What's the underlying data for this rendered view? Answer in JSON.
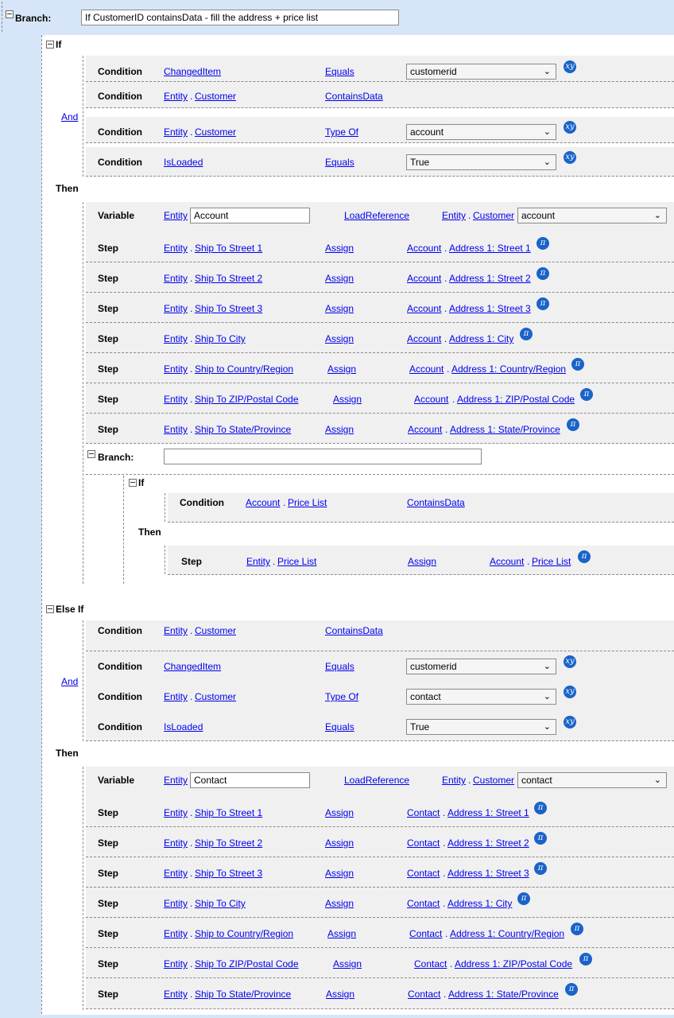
{
  "branch": {
    "label": "Branch:",
    "value": "If CustomerID containsData - fill the address + price list"
  },
  "if": {
    "label": "If"
  },
  "and": "And",
  "then": "Then",
  "else_if": {
    "label": "Else If"
  },
  "cond": "Condition",
  "var": "Variable",
  "step": "Step",
  "dot": ".",
  "ops": {
    "equals": "Equals",
    "contains": "ContainsData",
    "typeof": "Type Of",
    "assign": "Assign",
    "loadref": "LoadReference"
  },
  "fields": {
    "changed": "ChangedItem",
    "entity": "Entity",
    "customer": "Customer",
    "isloaded": "IsLoaded",
    "account": "Account",
    "contact": "Contact",
    "pricelist": "Price List",
    "st1": "Ship To Street 1",
    "st2": "Ship To Street 2",
    "st3": "Ship To Street 3",
    "city": "Ship To City",
    "country": "Ship to Country/Region",
    "zip": "Ship To ZIP/Postal Code",
    "state": "Ship To State/Province",
    "a1": "Address 1: Street 1",
    "a2": "Address 1: Street 2",
    "a3": "Address 1: Street 3",
    "acity": "Address 1: City",
    "acountry": "Address 1: Country/Region",
    "azip": "Address 1: ZIP/Postal Code",
    "astate": "Address 1: State/Province"
  },
  "values": {
    "customerid": "customerid",
    "account": "account",
    "contact": "contact",
    "true": "True"
  },
  "inner_branch": {
    "label": "Branch:",
    "value": ""
  },
  "var_names": {
    "account": "Account",
    "contact": "Contact"
  },
  "icons": {
    "xy_label": "xy",
    "pi_label": "π",
    "chevron": "⌄",
    "badge_color": "#1a63c9",
    "link_color": "#0000ee"
  }
}
